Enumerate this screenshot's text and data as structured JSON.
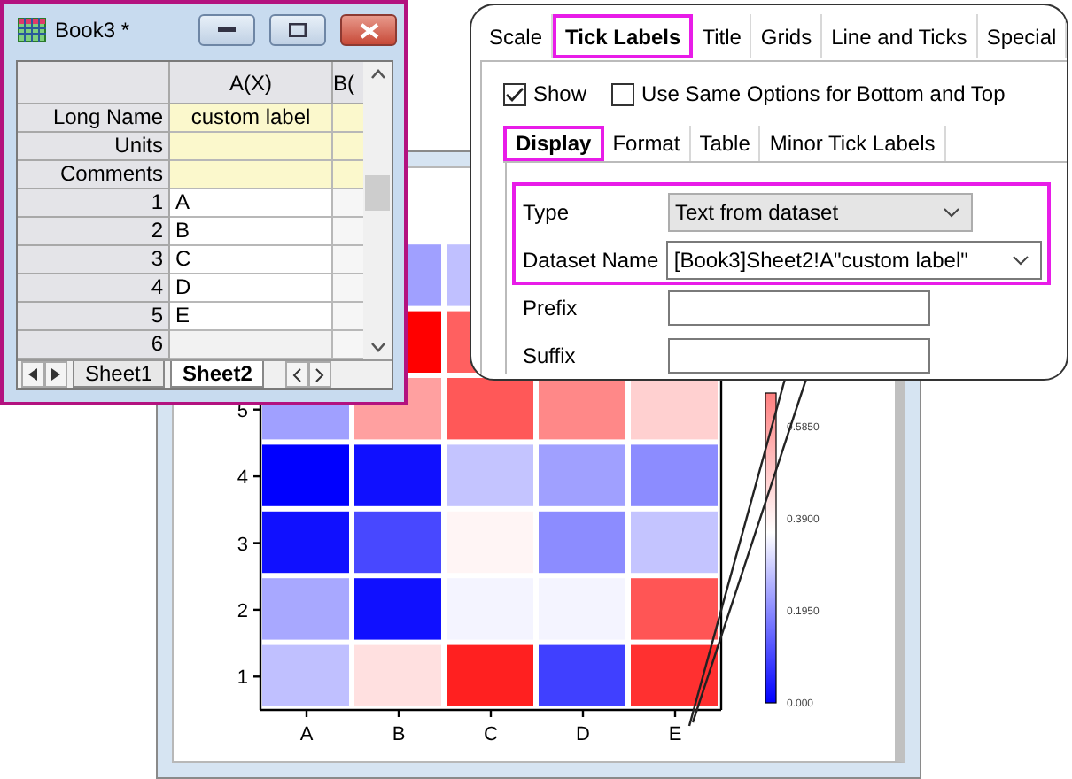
{
  "workbook": {
    "title": "Book3 *",
    "columns": [
      {
        "label": "A(X)"
      },
      {
        "label": "B("
      }
    ],
    "label_rows": [
      {
        "name": "Long Name",
        "a": "custom label"
      },
      {
        "name": "Units"
      },
      {
        "name": "Comments"
      }
    ],
    "rows": [
      {
        "number": "1",
        "a": "A"
      },
      {
        "number": "2",
        "a": "B"
      },
      {
        "number": "3",
        "a": "C"
      },
      {
        "number": "4",
        "a": "D"
      },
      {
        "number": "5",
        "a": "E"
      },
      {
        "number": "6"
      }
    ],
    "sheets": [
      {
        "label": "Sheet1",
        "selected": false
      },
      {
        "label": "Sheet2",
        "selected": true
      }
    ]
  },
  "graph": {
    "x_labels": [
      "A",
      "B",
      "C",
      "D",
      "E"
    ],
    "y_labels": [
      "5",
      "4",
      "3",
      "2",
      "1"
    ],
    "colorbar_labels": [
      "0.5850",
      "0.3900",
      "0.1950",
      "0.000"
    ]
  },
  "dialog": {
    "tabs": [
      {
        "label": "Scale",
        "selected": false
      },
      {
        "label": "Tick Labels",
        "selected": true
      },
      {
        "label": "Title",
        "selected": false
      },
      {
        "label": "Grids",
        "selected": false
      },
      {
        "label": "Line and Ticks",
        "selected": false
      },
      {
        "label": "Special",
        "selected": false
      }
    ],
    "options": [
      {
        "label": "Show",
        "checked": true
      },
      {
        "label": "Use Same Options for Bottom and Top",
        "checked": false
      }
    ],
    "subtabs": [
      {
        "label": "Display",
        "selected": true
      },
      {
        "label": "Format",
        "selected": false
      },
      {
        "label": "Table",
        "selected": false
      },
      {
        "label": "Minor Tick Labels",
        "selected": false
      }
    ],
    "fields": [
      {
        "kind": "select",
        "label": "Type",
        "value": "Text from dataset",
        "highlighted": true
      },
      {
        "kind": "combo",
        "label": "Dataset Name",
        "value": "[Book3]Sheet2!A\"custom label\"",
        "highlighted": true
      },
      {
        "kind": "text",
        "label": "Prefix",
        "highlighted": false
      },
      {
        "kind": "text",
        "label": "Suffix",
        "highlighted": false
      }
    ]
  }
}
